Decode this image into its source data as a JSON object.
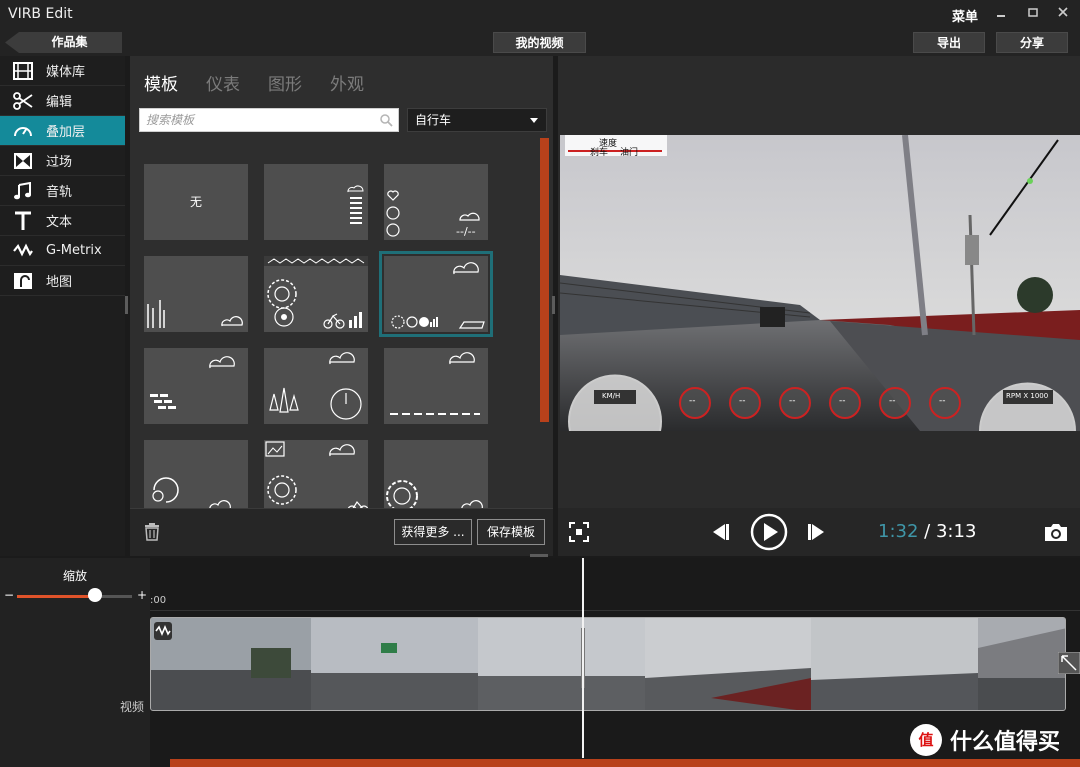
{
  "app": {
    "title": "VIRB Edit",
    "menu_label": "菜单"
  },
  "toolbar": {
    "back_label": "作品集",
    "center_label": "我的视频",
    "export_label": "导出",
    "share_label": "分享"
  },
  "sidebar": {
    "items": [
      {
        "label": "媒体库",
        "icon": "film-icon"
      },
      {
        "label": "编辑",
        "icon": "scissors-icon"
      },
      {
        "label": "叠加层",
        "icon": "gauge-icon",
        "active": true
      },
      {
        "label": "过场",
        "icon": "transition-icon"
      },
      {
        "label": "音轨",
        "icon": "music-note-icon"
      },
      {
        "label": "文本",
        "icon": "text-icon"
      },
      {
        "label": "G-Metrix",
        "icon": "g-metrix-icon"
      },
      {
        "label": "地图",
        "icon": "map-icon"
      }
    ]
  },
  "templates": {
    "tabs": [
      "模板",
      "仪表",
      "图形",
      "外观"
    ],
    "active_tab": "模板",
    "search_placeholder": "搜索模板",
    "filter_value": "自行车",
    "none_label": "无",
    "tile_sample_text": "--/--",
    "get_more_label": "获得更多 ...",
    "save_template_label": "保存模板"
  },
  "player": {
    "current_time": "1:32",
    "separator": "/",
    "total_time": "3:13",
    "overlay_top_text": "速度",
    "overlay_sub_left": "刹车",
    "overlay_sub_right": "油门",
    "gauge_left_unit": "KM/H",
    "gauge_right_unit": "RPM X 1000",
    "small_gauge_value": "--"
  },
  "timeline": {
    "zoom_label": "缩放",
    "zoom_minus": "−",
    "zoom_plus": "+",
    "zoom_level": 0.68,
    "ruler_start": ":00",
    "track_name": "视频"
  },
  "watermark": {
    "logo_text": "值",
    "text": "什么值得买"
  },
  "colors": {
    "accent_teal": "#148a9a",
    "accent_orange": "#e0532a",
    "scroll_orange": "#b8411b",
    "time_current": "#3f96a8"
  }
}
